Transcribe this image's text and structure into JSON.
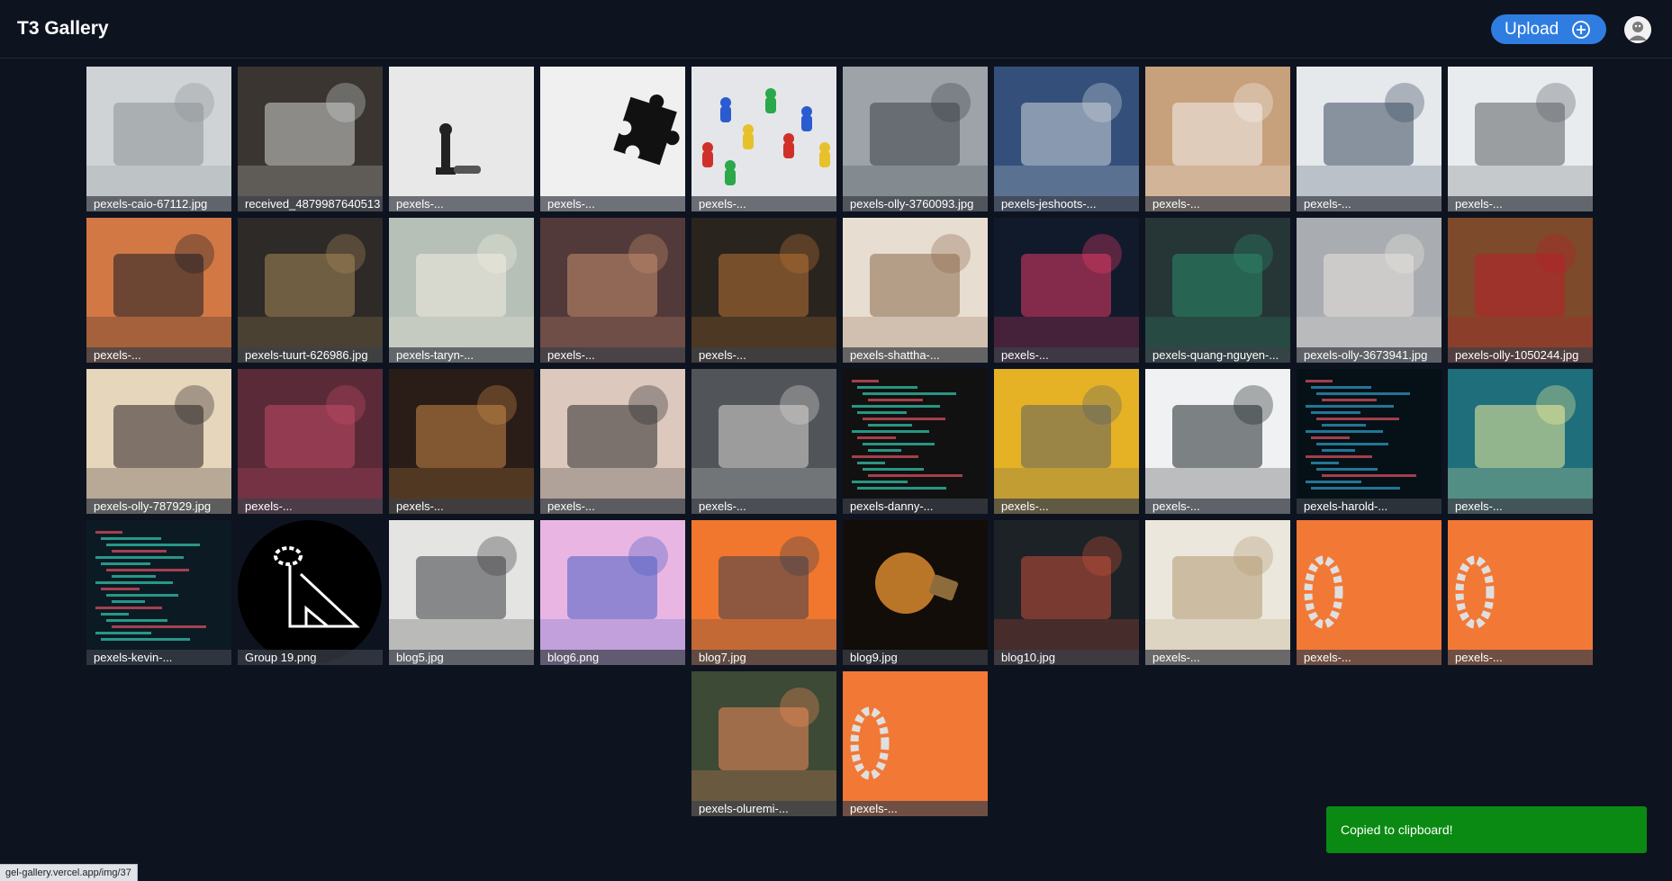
{
  "header": {
    "title": "T3 Gallery",
    "upload_label": "Upload",
    "upload_icon": "plus-circle-icon",
    "avatar_icon": "user-avatar-icon"
  },
  "colors": {
    "background": "#0e1320",
    "accent": "#2f7de1",
    "toast": "#0a8a12"
  },
  "images": [
    {
      "caption": "pexels-caio-67112.jpg",
      "scene": "laptop",
      "colors": [
        "#cfd3d6",
        "#8d9296"
      ]
    },
    {
      "caption": "received_4879987640513",
      "scene": "id-card",
      "colors": [
        "#3a3530",
        "#cfd2d0"
      ]
    },
    {
      "caption": "pexels-...",
      "scene": "chess-piece",
      "colors": [
        "#e8e8e9",
        "#222"
      ]
    },
    {
      "caption": "pexels-...",
      "scene": "puzzle",
      "colors": [
        "#f0f0f0",
        "#111"
      ]
    },
    {
      "caption": "pexels-...",
      "scene": "pawns",
      "colors": [
        "#e5e6ea",
        "#d0302a"
      ]
    },
    {
      "caption": "pexels-olly-3760093.jpg",
      "scene": "office",
      "colors": [
        "#9da3a8",
        "#3c4248"
      ]
    },
    {
      "caption": "pexels-jeshoots-...",
      "scene": "chess-board",
      "colors": [
        "#34507a",
        "#cfd5dc"
      ]
    },
    {
      "caption": "pexels-...",
      "scene": "desk-papers",
      "colors": [
        "#c7a07c",
        "#f4f1ec"
      ]
    },
    {
      "caption": "pexels-...",
      "scene": "whiteboard-meeting",
      "colors": [
        "#e6e9ec",
        "#3a4a60"
      ]
    },
    {
      "caption": "pexels-...",
      "scene": "whiteboard",
      "colors": [
        "#e9ecee",
        "#5b5f63"
      ]
    },
    {
      "caption": "pexels-...",
      "scene": "phone-shop",
      "colors": [
        "#d27845",
        "#1a1c25"
      ]
    },
    {
      "caption": "pexels-tuurt-626986.jpg",
      "scene": "bookstore",
      "colors": [
        "#2d2a27",
        "#a58858"
      ]
    },
    {
      "caption": "pexels-taryn-...",
      "scene": "book-lemons",
      "colors": [
        "#b7c0b6",
        "#f2ede2"
      ]
    },
    {
      "caption": "pexels-...",
      "scene": "shopfront",
      "colors": [
        "#52393a",
        "#c58f6d"
      ]
    },
    {
      "caption": "pexels-...",
      "scene": "shoes",
      "colors": [
        "#2a241f",
        "#b87335"
      ]
    },
    {
      "caption": "pexels-shattha-...",
      "scene": "boutique",
      "colors": [
        "#e8ddd1",
        "#8b6a4c"
      ]
    },
    {
      "caption": "pexels-...",
      "scene": "neon-street",
      "colors": [
        "#101a2b",
        "#e43b67"
      ]
    },
    {
      "caption": "pexels-quang-nguyen-...",
      "scene": "cafe",
      "colors": [
        "#263536",
        "#2a8a6a"
      ]
    },
    {
      "caption": "pexels-olly-3673941.jpg",
      "scene": "bed",
      "colors": [
        "#a9acb0",
        "#e9e5e0"
      ]
    },
    {
      "caption": "pexels-olly-1050244.jpg",
      "scene": "gifts",
      "colors": [
        "#7d4a2b",
        "#b8202a"
      ]
    },
    {
      "caption": "pexels-olly-787929.jpg",
      "scene": "woman-phone",
      "colors": [
        "#e6d6bc",
        "#2a2325"
      ]
    },
    {
      "caption": "pexels-...",
      "scene": "market",
      "colors": [
        "#5a2a38",
        "#c24b66"
      ]
    },
    {
      "caption": "pexels-...",
      "scene": "bar",
      "colors": [
        "#2a1c16",
        "#c88a4b"
      ]
    },
    {
      "caption": "pexels-...",
      "scene": "window-men",
      "colors": [
        "#dcc8bd",
        "#2b2b2e"
      ]
    },
    {
      "caption": "pexels-...",
      "scene": "people-papers",
      "colors": [
        "#51555a",
        "#d9d7d2"
      ]
    },
    {
      "caption": "pexels-danny-...",
      "scene": "code-laptop",
      "colors": [
        "#111",
        "#2fb6a0"
      ]
    },
    {
      "caption": "pexels-...",
      "scene": "laptop-yellow",
      "colors": [
        "#e5b225",
        "#5c6165"
      ]
    },
    {
      "caption": "pexels-...",
      "scene": "monitors",
      "colors": [
        "#f0f1f2",
        "#1e2528"
      ]
    },
    {
      "caption": "pexels-harold-...",
      "scene": "code-dark",
      "colors": [
        "#061017",
        "#2a8fb4"
      ]
    },
    {
      "caption": "pexels-...",
      "scene": "code-note",
      "colors": [
        "#1e6e7c",
        "#f4f09a"
      ]
    },
    {
      "caption": "pexels-kevin-...",
      "scene": "code-glasses",
      "colors": [
        "#0c1a24",
        "#2fb6a0"
      ]
    },
    {
      "caption": "Group 19.png",
      "scene": "logo",
      "colors": [
        "#0e1320",
        "#ffffff"
      ]
    },
    {
      "caption": "blog5.jpg",
      "scene": "laptop-top",
      "colors": [
        "#e4e4e2",
        "#3b3d40"
      ]
    },
    {
      "caption": "blog6.png",
      "scene": "robot-pink",
      "colors": [
        "#e9b6e4",
        "#4a5fc2"
      ]
    },
    {
      "caption": "blog7.jpg",
      "scene": "robot-head",
      "colors": [
        "#f1772f",
        "#3a3f4c"
      ]
    },
    {
      "caption": "blog9.jpg",
      "scene": "bulb",
      "colors": [
        "#120d09",
        "#d8892e"
      ]
    },
    {
      "caption": "blog10.jpg",
      "scene": "board",
      "colors": [
        "#1d2226",
        "#c5503a"
      ]
    },
    {
      "caption": "pexels-...",
      "scene": "open-book",
      "colors": [
        "#ece7dc",
        "#b39a73"
      ]
    },
    {
      "caption": "pexels-...",
      "scene": "chain-zero",
      "colors": [
        "#f27836",
        "#dfdfdf"
      ]
    },
    {
      "caption": "pexels-...",
      "scene": "chain-zero",
      "colors": [
        "#f27836",
        "#dfdfdf"
      ]
    },
    {
      "caption": "pexels-oluremi-...",
      "scene": "yoga",
      "colors": [
        "#3c4a36",
        "#f08a5a"
      ]
    },
    {
      "caption": "pexels-...",
      "scene": "chain-zero",
      "colors": [
        "#f27836",
        "#dfdfdf"
      ]
    }
  ],
  "toast": {
    "message": "Copied to clipboard!"
  },
  "status_bar": {
    "url": "gel-gallery.vercel.app/img/37"
  }
}
